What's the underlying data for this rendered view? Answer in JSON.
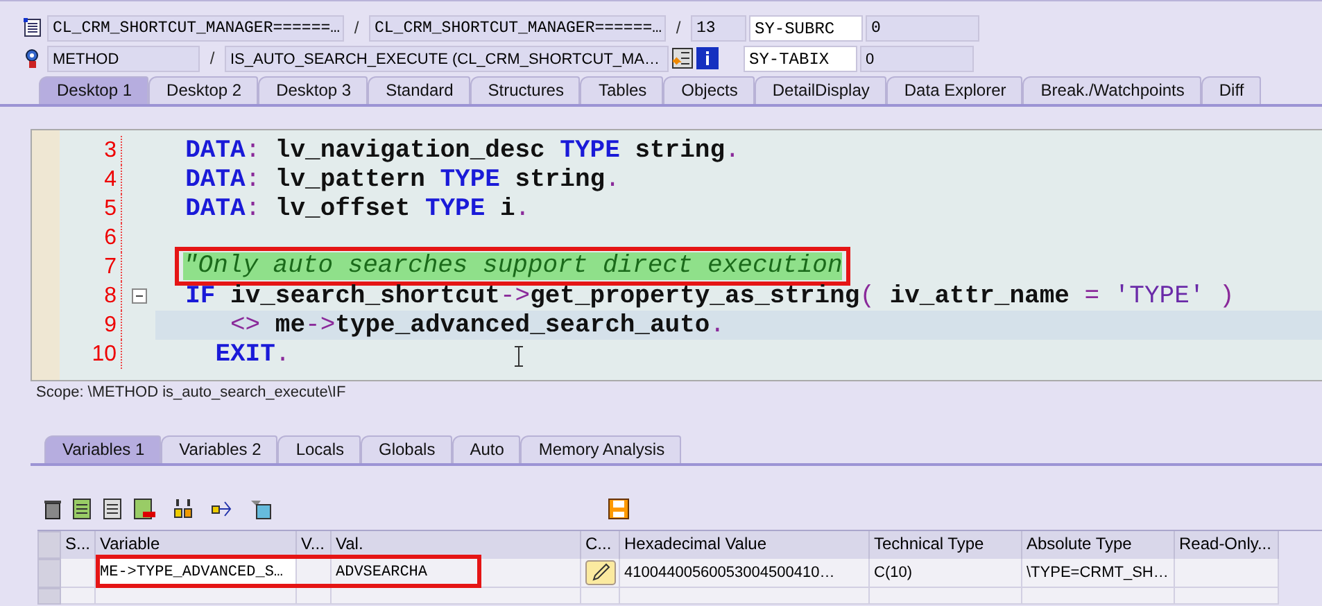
{
  "header": {
    "rows": [
      {
        "fields": [
          {
            "text": "CL_CRM_SHORTCUT_MANAGER======…",
            "kind": "grey"
          },
          {
            "text": "/",
            "kind": "slash"
          },
          {
            "text": "CL_CRM_SHORTCUT_MANAGER======…",
            "kind": "grey"
          },
          {
            "text": "/",
            "kind": "slash"
          },
          {
            "text": "13",
            "kind": "grey"
          },
          {
            "text": "SY-SUBRC",
            "kind": "white"
          },
          {
            "text": "0",
            "kind": "grey"
          }
        ]
      },
      {
        "fields": [
          {
            "text": "METHOD",
            "kind": "grey"
          },
          {
            "text": "/",
            "kind": "slash"
          },
          {
            "text": "IS_AUTO_SEARCH_EXECUTE (CL_CRM_SHORTCUT_MA…",
            "kind": "grey"
          },
          {
            "text": "SY-TABIX",
            "kind": "white"
          },
          {
            "text": "0",
            "kind": "grey"
          }
        ]
      }
    ]
  },
  "tabs": [
    {
      "label": "Desktop 1",
      "selected": true
    },
    {
      "label": "Desktop 2",
      "selected": false
    },
    {
      "label": "Desktop 3",
      "selected": false
    },
    {
      "label": "Standard",
      "selected": false
    },
    {
      "label": "Structures",
      "selected": false
    },
    {
      "label": "Tables",
      "selected": false
    },
    {
      "label": "Objects",
      "selected": false
    },
    {
      "label": "DetailDisplay",
      "selected": false
    },
    {
      "label": "Data Explorer",
      "selected": false
    },
    {
      "label": "Break./Watchpoints",
      "selected": false
    },
    {
      "label": "Diff",
      "selected": false
    }
  ],
  "editor": {
    "lines": [
      {
        "number": "3",
        "current": false,
        "annotated": false,
        "foldable": false,
        "tokens": [
          {
            "kind": "keyword",
            "text": "  DATA"
          },
          {
            "kind": "op",
            "text": ":"
          },
          {
            "kind": "ident",
            "text": " lv_navigation_desc "
          },
          {
            "kind": "keyword",
            "text": "TYPE"
          },
          {
            "kind": "ident",
            "text": " string"
          },
          {
            "kind": "op",
            "text": "."
          }
        ]
      },
      {
        "number": "4",
        "current": false,
        "annotated": false,
        "foldable": false,
        "tokens": [
          {
            "kind": "keyword",
            "text": "  DATA"
          },
          {
            "kind": "op",
            "text": ":"
          },
          {
            "kind": "ident",
            "text": " lv_pattern "
          },
          {
            "kind": "keyword",
            "text": "TYPE"
          },
          {
            "kind": "ident",
            "text": " string"
          },
          {
            "kind": "op",
            "text": "."
          }
        ]
      },
      {
        "number": "5",
        "current": false,
        "annotated": false,
        "foldable": false,
        "tokens": [
          {
            "kind": "keyword",
            "text": "  DATA"
          },
          {
            "kind": "op",
            "text": ":"
          },
          {
            "kind": "ident",
            "text": " lv_offset "
          },
          {
            "kind": "keyword",
            "text": "TYPE"
          },
          {
            "kind": "ident",
            "text": " i"
          },
          {
            "kind": "op",
            "text": "."
          }
        ]
      },
      {
        "number": "6",
        "current": false,
        "annotated": false,
        "foldable": false
      },
      {
        "number": "7",
        "current": false,
        "annotated": true,
        "foldable": false,
        "tokens": [
          {
            "kind": "comment",
            "text": "\"Only auto searches support direct execution"
          }
        ]
      },
      {
        "number": "8",
        "current": false,
        "annotated": false,
        "foldable": true,
        "tokens": [
          {
            "kind": "keyword",
            "text": "  IF"
          },
          {
            "kind": "ident",
            "text": " iv_search_shortcut"
          },
          {
            "kind": "op",
            "text": "->"
          },
          {
            "kind": "ident",
            "text": "get_property_as_string"
          },
          {
            "kind": "op",
            "text": "("
          },
          {
            "kind": "ident",
            "text": " iv_attr_name "
          },
          {
            "kind": "op",
            "text": "="
          },
          {
            "kind": "string",
            "text": " 'TYPE' "
          },
          {
            "kind": "op",
            "text": ")"
          }
        ]
      },
      {
        "number": "9",
        "current": true,
        "annotated": false,
        "foldable": false,
        "tokens": [
          {
            "kind": "op",
            "text": "     <>"
          },
          {
            "kind": "ident",
            "text": " me"
          },
          {
            "kind": "op",
            "text": "->"
          },
          {
            "kind": "ident",
            "text": "type_advanced_search_auto"
          },
          {
            "kind": "op",
            "text": "."
          }
        ]
      },
      {
        "number": "10",
        "current": false,
        "annotated": false,
        "foldable": false,
        "tokens": [
          {
            "kind": "keyword",
            "text": "    EXIT"
          },
          {
            "kind": "op",
            "text": "."
          }
        ]
      }
    ]
  },
  "scope": "Scope: \\METHOD is_auto_search_execute\\IF",
  "lower_tabs": [
    {
      "label": "Variables 1",
      "selected": true
    },
    {
      "label": "Variables 2",
      "selected": false
    },
    {
      "label": "Locals",
      "selected": false
    },
    {
      "label": "Globals",
      "selected": false
    },
    {
      "label": "Auto",
      "selected": false
    },
    {
      "label": "Memory Analysis",
      "selected": false
    }
  ],
  "table": {
    "columns": [
      "S...",
      "Variable",
      "V...",
      "Val.",
      "C...",
      "Hexadecimal Value",
      "Technical Type",
      "Absolute Type",
      "Read-Only..."
    ],
    "rows": [
      {
        "annotated": true,
        "cells": [
          "",
          "ME->TYPE_ADVANCED_S…",
          "",
          "ADVSEARCHA",
          "",
          "41004400560053004500410…",
          "C(10)",
          "\\TYPE=CRMT_SH…",
          ""
        ]
      }
    ]
  }
}
